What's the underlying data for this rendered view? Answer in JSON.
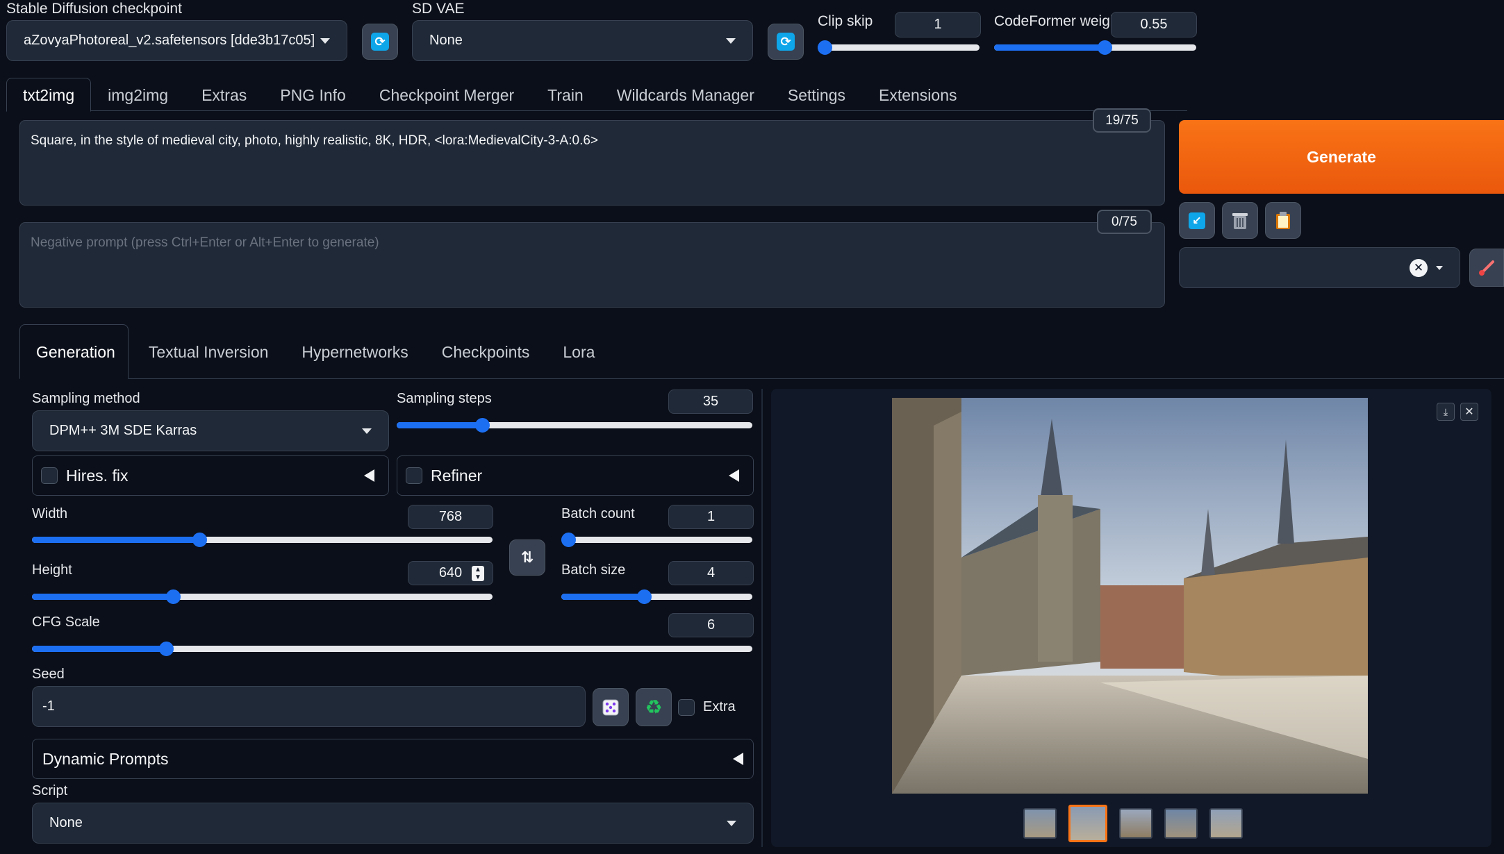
{
  "top": {
    "checkpoint_label": "Stable Diffusion checkpoint",
    "checkpoint_value": "aZovyaPhotoreal_v2.safetensors [dde3b17c05]",
    "vae_label": "SD VAE",
    "vae_value": "None",
    "clip_skip_label": "Clip skip",
    "clip_skip_value": "1",
    "clip_skip_fraction": 0.0,
    "codeformer_label": "CodeFormer weight",
    "codeformer_value": "0.55",
    "codeformer_fraction": 0.55
  },
  "tabs": [
    "txt2img",
    "img2img",
    "Extras",
    "PNG Info",
    "Checkpoint Merger",
    "Train",
    "Wildcards Manager",
    "Settings",
    "Extensions"
  ],
  "prompt": {
    "positive": "Square, in the style of medieval city, photo, highly realistic, 8K, HDR, <lora:MedievalCity-3-A:0.6>",
    "positive_count": "19/75",
    "negative_placeholder": "Negative prompt (press Ctrl+Enter or Alt+Enter to generate)",
    "negative_count": "0/75"
  },
  "generate_label": "Generate",
  "subtabs": [
    "Generation",
    "Textual Inversion",
    "Hypernetworks",
    "Checkpoints",
    "Lora"
  ],
  "params": {
    "sampling_method_label": "Sampling method",
    "sampling_method_value": "DPM++ 3M SDE Karras",
    "sampling_steps_label": "Sampling steps",
    "sampling_steps_value": "35",
    "sampling_steps_fraction": 0.23,
    "hires_label": "Hires. fix",
    "refiner_label": "Refiner",
    "width_label": "Width",
    "width_value": "768",
    "width_fraction": 0.36,
    "height_label": "Height",
    "height_value": "640",
    "height_fraction": 0.3,
    "batch_count_label": "Batch count",
    "batch_count_value": "1",
    "batch_count_fraction": 0.0,
    "batch_size_label": "Batch size",
    "batch_size_value": "4",
    "batch_size_fraction": 0.43,
    "cfg_label": "CFG Scale",
    "cfg_value": "6",
    "cfg_fraction": 0.18,
    "seed_label": "Seed",
    "seed_value": "-1",
    "extra_label": "Extra",
    "dynamic_prompts_label": "Dynamic Prompts",
    "script_label": "Script",
    "script_value": "None"
  },
  "gallery": {
    "thumb_count": 5,
    "selected_index": 1
  },
  "colors": {
    "accent": "#1d6ff2",
    "generate_start": "#f97316",
    "generate_end": "#ea580c",
    "background": "#0b0f19"
  }
}
